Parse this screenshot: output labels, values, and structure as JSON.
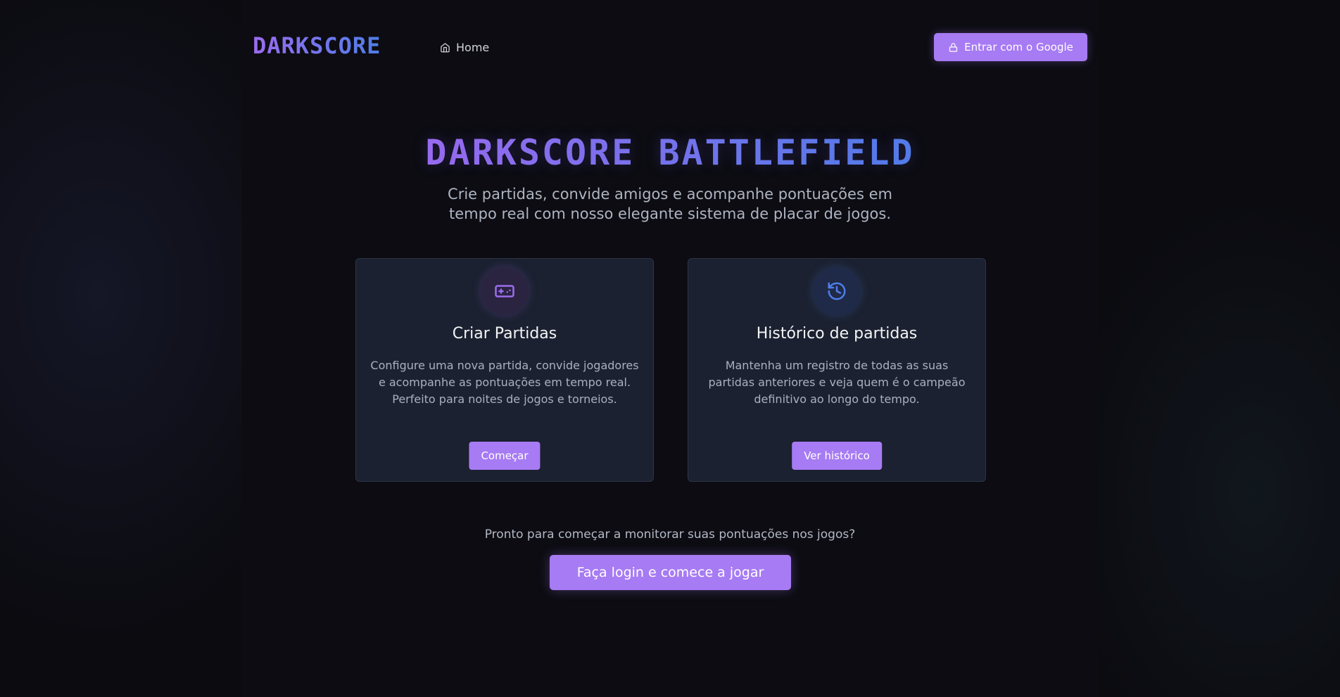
{
  "header": {
    "logo": "DARKSCORE",
    "nav_home": "Home",
    "login_button": "Entrar com o Google"
  },
  "hero": {
    "title": "DARKSCORE BATTLEFIELD",
    "subtitle": "Crie partidas, convide amigos e acompanhe pontuações em tempo real com nosso elegante sistema de placar de jogos."
  },
  "cards": [
    {
      "title": "Criar Partidas",
      "description": "Configure uma nova partida, convide jogadores e acompanhe as pontuações em tempo real. Perfeito para noites de jogos e torneios.",
      "button": "Começar",
      "icon": "gamepad-icon"
    },
    {
      "title": "Histórico de partidas",
      "description": "Mantenha um registro de todas as suas partidas anteriores e veja quem é o campeão definitivo ao longo do tempo.",
      "button": "Ver histórico",
      "icon": "history-icon"
    }
  ],
  "cta": {
    "text": "Pronto para começar a monitorar suas pontuações nos jogos?",
    "button": "Faça login e comece a jogar"
  },
  "colors": {
    "accent": "#a77bf3",
    "gradient_start": "#9b6cf0",
    "gradient_end": "#4f7ee8",
    "card_bg": "#1b2130",
    "page_bg": "#0b0b10"
  }
}
